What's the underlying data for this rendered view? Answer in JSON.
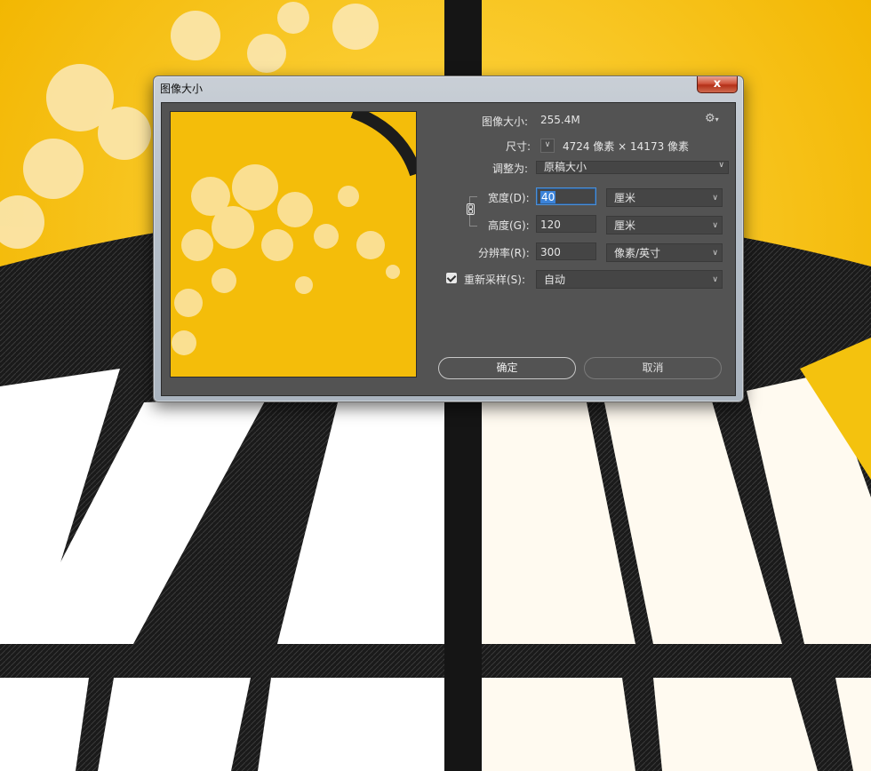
{
  "dialog": {
    "title": "图像大小",
    "close_label": "x"
  },
  "info": {
    "image_size_label": "图像大小:",
    "image_size_value": "255.4M",
    "dimensions_label": "尺寸:",
    "dimensions_value": "4724 像素  ×  14173 像素"
  },
  "fit_to": {
    "label": "调整为:",
    "value": "原稿大小"
  },
  "width": {
    "label": "宽度(D):",
    "value": "40",
    "unit": "厘米"
  },
  "height": {
    "label": "高度(G):",
    "value": "120",
    "unit": "厘米"
  },
  "resolution": {
    "label": "分辨率(R):",
    "value": "300",
    "unit": "像素/英寸"
  },
  "resample": {
    "checked": true,
    "label": "重新采样(S):",
    "value": "自动"
  },
  "buttons": {
    "ok": "确定",
    "cancel": "取消"
  },
  "colors": {
    "panel": "#535353",
    "accent_yellow": "#f4bd0a",
    "selection_blue": "#3b83d9"
  },
  "icons": [
    "gear-icon",
    "chevron-down-icon",
    "chain-link-icon",
    "checkbox-icon",
    "close-icon"
  ]
}
